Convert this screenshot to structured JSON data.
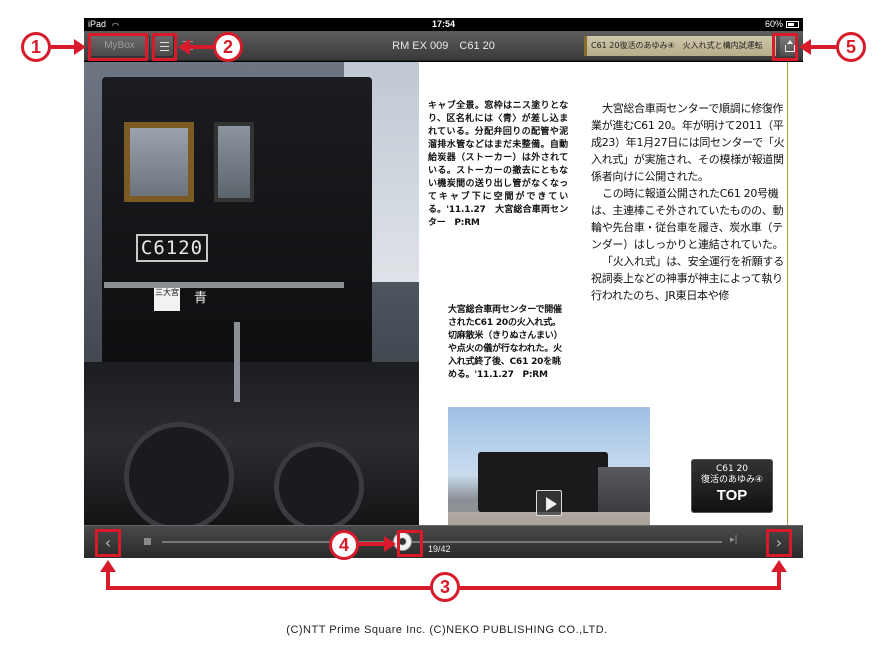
{
  "status_bar": {
    "device": "iPad",
    "time": "17:54",
    "battery": "60%"
  },
  "toolbar": {
    "mybox_label": "MyBox",
    "title": "RM EX 009　C61 20",
    "chapter": "C61 20復活のあゆみ④　火入れ式と構内試運転"
  },
  "photo": {
    "number_plate": "C6120",
    "depot_plate": "三大宮",
    "ao": "青"
  },
  "captions": {
    "left": "キャブ全景。窓枠はニス塗りとなり、区名札には〈青〉が差し込まれている。分配弁回りの配管や泥溜排水管などはまだ未整備。自動給炭器（ストーカー）は外されている。ストーカーの撤去にともない機炭間の送り出し管がなくなってキャブ下に空間ができている。'11.1.27　大宮総合車両センター　P:RM",
    "second": "大宮総合車両センターで開催されたC61 20の火入れ式。切麻散米（きりぬさんまい）や点火の儀が行なわれた。火入れ式終了後、C61 20を眺める。'11.1.27　P:RM"
  },
  "main_text": [
    "大宮総合車両センターで順調に修復作業が進むC61 20。年が明けて2011（平成23）年1月27日には同センターで「火入れ式」が実施され、その模様が報道関係者向けに公開された。",
    "この時に報道公開されたC61 20号機は、主連棒こそ外されていたものの、動輪や先台車・従台車を履き、炭水車（テンダー）はしっかりと連結されていた。",
    "「火入れ式」は、安全運行を祈願する祝詞奏上などの神事が神主によって執り行われたのち、JR東日本や修"
  ],
  "top_button": {
    "line1": "C61 20",
    "line2": "復活のあゆみ④",
    "line3": "TOP"
  },
  "navbar": {
    "prev": "‹",
    "next": "›",
    "page_indicator": "19/42",
    "last_page": "▸|",
    "page_position": 0.43
  },
  "annotations": {
    "b1": "1",
    "b2": "2",
    "b3": "3",
    "b4": "4",
    "b5": "5"
  },
  "copyright": "(C)NTT Prime Square Inc. (C)NEKO PUBLISHING CO.,LTD.",
  "colors": {
    "annotation": "#d81b2a",
    "toolbar": "#4a4a4a",
    "page_edge": "#b59a4a"
  }
}
